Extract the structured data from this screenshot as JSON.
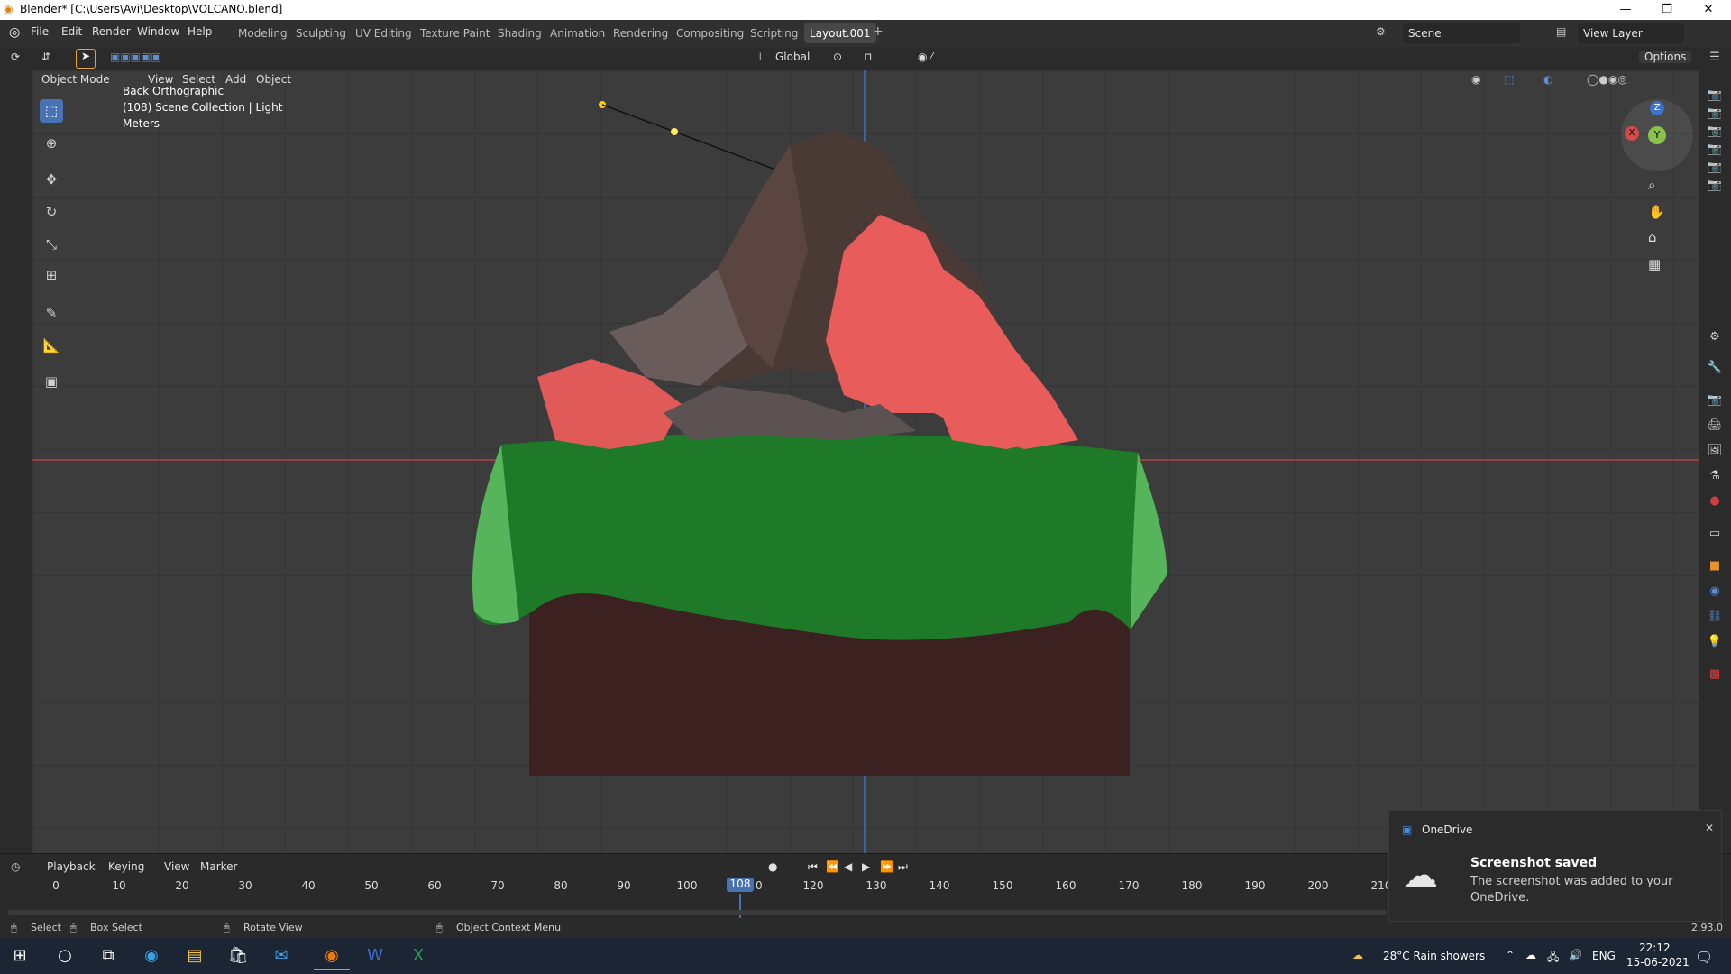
{
  "window": {
    "title": "Blender* [C:\\Users\\Avi\\Desktop\\VOLCANO.blend]",
    "minimize": "—",
    "restore": "❐",
    "close": "✕"
  },
  "menu": [
    "File",
    "Edit",
    "Render",
    "Window",
    "Help"
  ],
  "workspaces": [
    {
      "label": "Modeling",
      "active": false
    },
    {
      "label": "Sculpting",
      "active": false
    },
    {
      "label": "UV Editing",
      "active": false
    },
    {
      "label": "Texture Paint",
      "active": false
    },
    {
      "label": "Shading",
      "active": false
    },
    {
      "label": "Animation",
      "active": false
    },
    {
      "label": "Rendering",
      "active": false
    },
    {
      "label": "Compositing",
      "active": false
    },
    {
      "label": "Scripting",
      "active": false
    },
    {
      "label": "Layout.001",
      "active": true
    }
  ],
  "add_workspace": "+",
  "scene": {
    "label": "Scene"
  },
  "view_layer": {
    "label": "View Layer"
  },
  "toolheader": {
    "orientation": "Global",
    "options": "Options"
  },
  "viewheader": {
    "mode": "Object Mode",
    "items": [
      "View",
      "Select",
      "Add",
      "Object"
    ]
  },
  "viewport_info": {
    "view": "Back Orthographic",
    "collection": "(108) Scene Collection | Light",
    "units": "Meters"
  },
  "gizmo": {
    "x": "X",
    "y": "Y",
    "z": "Z"
  },
  "timeline": {
    "menu": [
      "Playback",
      "Keying",
      "View",
      "Marker"
    ],
    "ticks": [
      "0",
      "10",
      "20",
      "30",
      "40",
      "50",
      "60",
      "70",
      "80",
      "90",
      "100",
      "120",
      "130",
      "140",
      "150",
      "160",
      "170",
      "180",
      "190",
      "200",
      "210"
    ],
    "current_frame": "108",
    "current_frame_suffix": "0"
  },
  "statusbar": {
    "select": "Select",
    "box_select": "Box Select",
    "rotate_view": "Rotate View",
    "context_menu": "Object Context Menu",
    "version": "2.93.0"
  },
  "toast": {
    "app": "OneDrive",
    "title": "Screenshot saved",
    "body": "The screenshot was added to your OneDrive.",
    "close": "✕"
  },
  "taskbar": {
    "weather": "28°C  Rain showers",
    "lang": "ENG",
    "time": "22:12",
    "date": "15-06-2021"
  },
  "colors": {
    "accent": "#4772b3",
    "ground_green": "#1e7a28",
    "lava": "#e85c5c",
    "rock": "#4a3a35",
    "soil": "#3b2220"
  }
}
